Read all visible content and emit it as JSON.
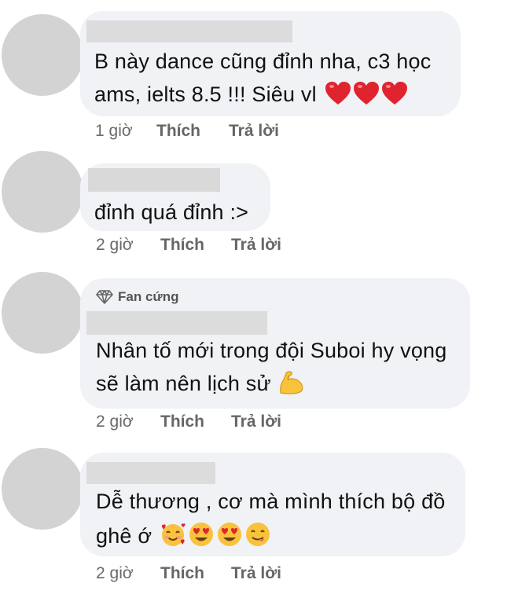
{
  "comments": [
    {
      "text_lines": [
        "B này dance cũng đỉnh nha,  c3 học",
        "ams, ielts 8.5 !!! Siêu vl"
      ],
      "emojis": [
        "red-heart-icon",
        "red-heart-icon",
        "red-heart-icon"
      ],
      "time": "1 giờ",
      "like": "Thích",
      "reply": "Trả lời"
    },
    {
      "text_lines": [
        "đỉnh quá đỉnh :>"
      ],
      "time": "2 giờ",
      "like": "Thích",
      "reply": "Trả lời"
    },
    {
      "badge": "Fan cứng",
      "text_lines": [
        "Nhân tố mới trong đội Suboi hy vọng",
        "sẽ làm nên lịch sử"
      ],
      "emojis": [
        "flexed-biceps-icon"
      ],
      "time": "2 giờ",
      "like": "Thích",
      "reply": "Trả lời"
    },
    {
      "text_lines": [
        "Dễ thương , cơ mà mình thích bộ đồ",
        "ghê ớ"
      ],
      "emojis": [
        "smiling-face-with-hearts-icon",
        "heart-eyes-icon",
        "heart-eyes-icon",
        "face-savoring-food-icon"
      ],
      "time": "2 giờ",
      "like": "Thích",
      "reply": "Trả lời"
    }
  ],
  "colors": {
    "bubble": "#f0f2f5",
    "avatar": "#d3d3d3",
    "heart": "#e0242f",
    "emoji_yellow": "#f9c23c"
  }
}
